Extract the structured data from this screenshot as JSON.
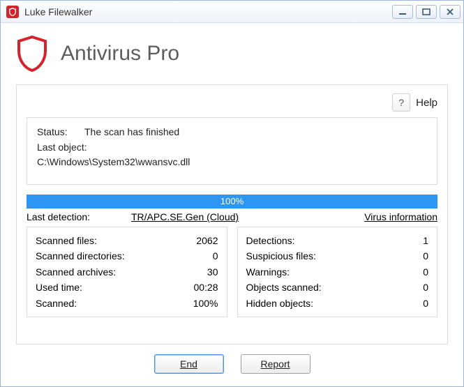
{
  "window": {
    "title": "Luke Filewalker"
  },
  "brand": {
    "name": "Antivirus Pro"
  },
  "help": {
    "icon": "?",
    "label": "Help"
  },
  "status": {
    "status_label": "Status:",
    "status_value": "The scan has finished",
    "last_object_label": "Last object:",
    "last_object_value": "C:\\Windows\\System32\\wwansvc.dll"
  },
  "progress": {
    "text": "100%"
  },
  "detection": {
    "label": "Last detection:",
    "name": "TR/APC.SE.Gen (Cloud)",
    "virus_info": "Virus information"
  },
  "stats_left": [
    {
      "label": "Scanned files:",
      "value": "2062"
    },
    {
      "label": "Scanned directories:",
      "value": "0"
    },
    {
      "label": "Scanned archives:",
      "value": "30"
    },
    {
      "label": "Used time:",
      "value": "00:28"
    },
    {
      "label": "Scanned:",
      "value": "100%"
    }
  ],
  "stats_right": [
    {
      "label": "Detections:",
      "value": "1"
    },
    {
      "label": "Suspicious files:",
      "value": "0"
    },
    {
      "label": "Warnings:",
      "value": "0"
    },
    {
      "label": "Objects scanned:",
      "value": "0"
    },
    {
      "label": "Hidden objects:",
      "value": "0"
    }
  ],
  "buttons": {
    "end": "End",
    "report": "Report"
  }
}
